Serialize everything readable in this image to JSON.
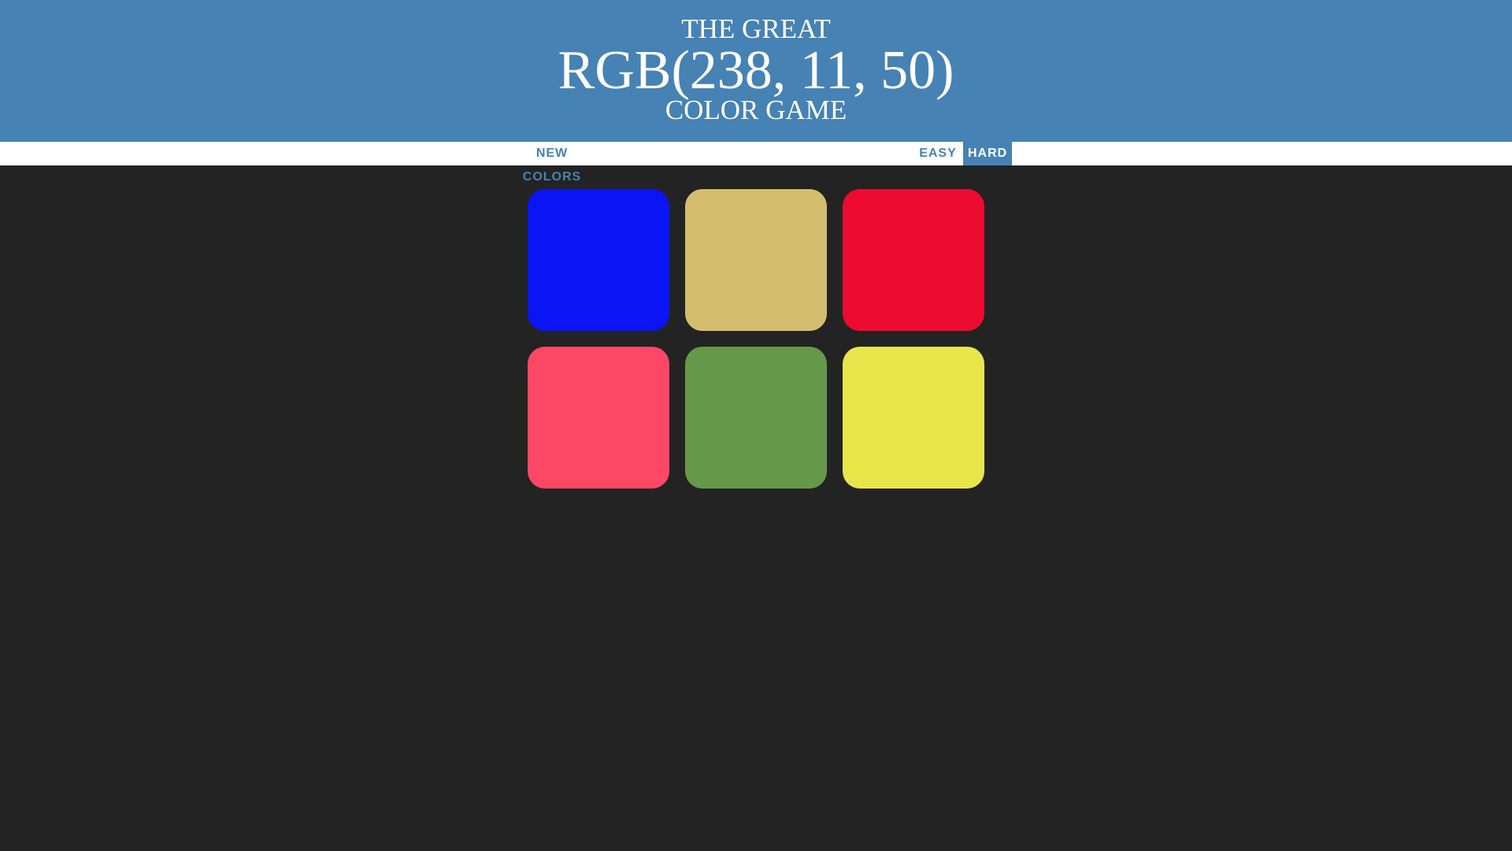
{
  "header": {
    "line1": "THE GREAT",
    "rgb_display": "RGB(238, 11, 50)",
    "line3": "COLOR GAME",
    "background": "#4682b4"
  },
  "stripe": {
    "new_colors_label": "NEW COLORS",
    "message": "",
    "easy_label": "EASY",
    "hard_label": "HARD",
    "selected_mode": "HARD",
    "accent": "#4682b4"
  },
  "squares": [
    {
      "color": "#0b14f5"
    },
    {
      "color": "#d4bd6e"
    },
    {
      "color": "#ee0b32"
    },
    {
      "color": "#fc4767"
    },
    {
      "color": "#669849"
    },
    {
      "color": "#e8e54b"
    }
  ],
  "body_background": "#232323"
}
